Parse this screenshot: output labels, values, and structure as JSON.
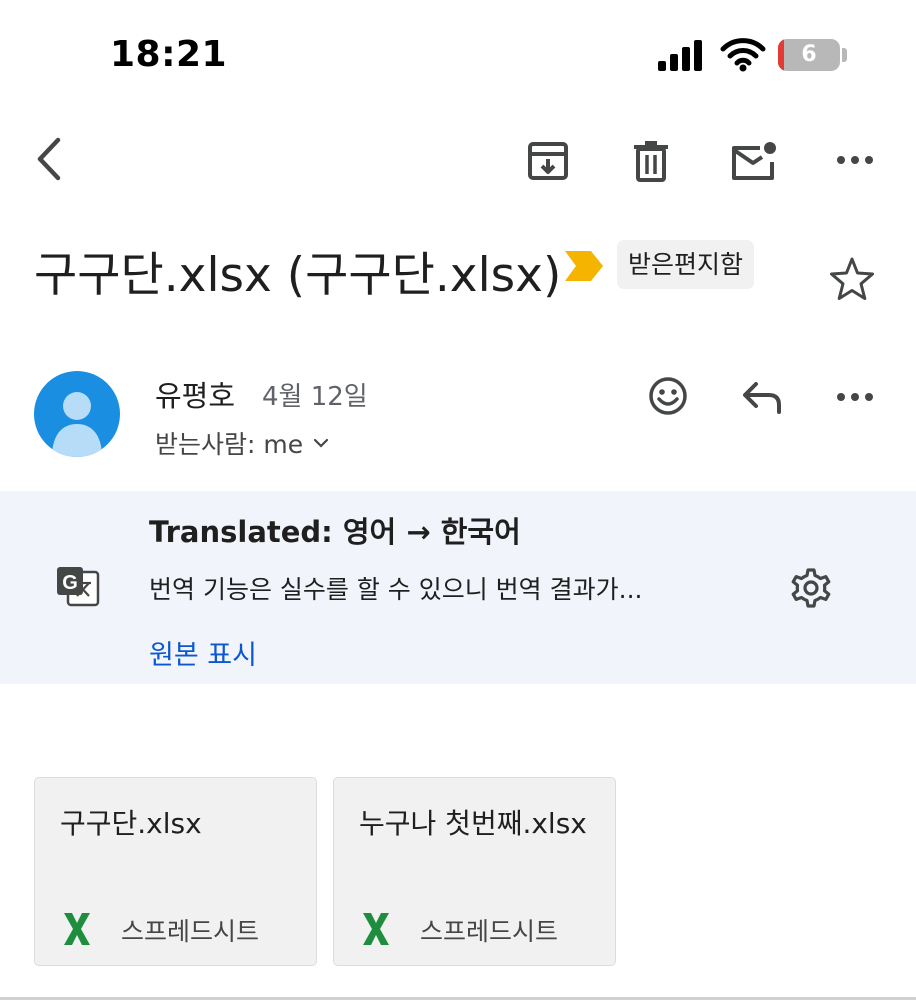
{
  "status_bar": {
    "time": "18:21",
    "battery": "6",
    "icons": [
      "cellular-signal-icon",
      "wifi-icon",
      "battery-icon"
    ]
  },
  "toolbar": {
    "icons": [
      "back-arrow-icon",
      "archive-icon",
      "trash-icon",
      "mark-unread-icon",
      "more-icon"
    ]
  },
  "email": {
    "subject": "구구단.xlsx (구구단.xlsx)",
    "label": "받은편지함",
    "label_color": "#f4b400",
    "sender_name": "유평호",
    "date": "4월 12일",
    "recipients": "받는사람: me",
    "avatar_color": "#1a8ee0"
  },
  "translation": {
    "title": "Translated: 영어 → 한국어",
    "description": "번역 기능은 실수를 할 수 있으니 번역 결과가...",
    "show_original": "원본 표시",
    "link_color": "#0b57d0"
  },
  "attachments": [
    {
      "name": "구구단.xlsx",
      "type": "스프레드시트"
    },
    {
      "name": "누구나 첫번째.xlsx",
      "type": "스프레드시트"
    }
  ],
  "colors": {
    "sheets_green": "#1e8e3e",
    "panel_bg": "#f1f5fb"
  }
}
